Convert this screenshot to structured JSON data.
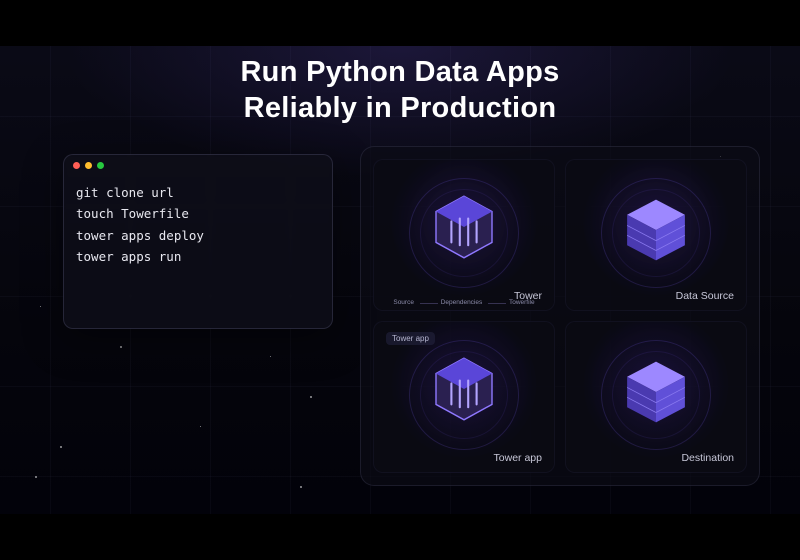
{
  "headline": {
    "line1": "Run Python Data Apps",
    "line2": "Reliably in Production"
  },
  "terminal": {
    "lines": [
      "git clone url",
      "touch Towerfile",
      "tower apps deploy",
      "tower apps run"
    ]
  },
  "cards": {
    "tower": {
      "label": "Tower",
      "sublabels": [
        "Source",
        "Dependencies",
        "Towerfile"
      ]
    },
    "data_source": {
      "label": "Data Source"
    },
    "tower_app": {
      "label": "Tower app",
      "tag": "Tower app"
    },
    "destination": {
      "label": "Destination"
    }
  },
  "colors": {
    "accent": "#6b4ef0",
    "cube_top": "#8f78ff",
    "cube_side": "#4a3ab0",
    "cube_side2": "#6050d8"
  }
}
